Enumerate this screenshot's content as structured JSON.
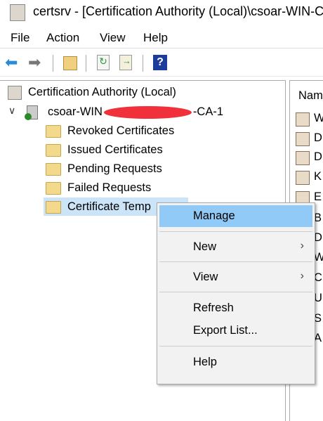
{
  "window": {
    "title": "certsrv - [Certification Authority (Local)\\csoar-WIN-C"
  },
  "menu": [
    "File",
    "Action",
    "View",
    "Help"
  ],
  "toolbar": [
    "back",
    "forward",
    "up-folder",
    "refresh",
    "export-list",
    "help"
  ],
  "tree": {
    "root": "Certification Authority (Local)",
    "server_prefix": "csoar-WIN",
    "server_suffix": "-CA-1",
    "children": [
      "Revoked Certificates",
      "Issued Certificates",
      "Pending Requests",
      "Failed Requests",
      "Certificate Temp"
    ]
  },
  "right_pane": {
    "header": "Nam",
    "items": [
      "W",
      "D",
      "D",
      "K",
      "E",
      "B",
      "D",
      "W",
      "C",
      "U",
      "S",
      "A"
    ]
  },
  "context_menu": {
    "items": [
      "Manage",
      "New",
      "View",
      "Refresh",
      "Export List...",
      "Help"
    ]
  }
}
